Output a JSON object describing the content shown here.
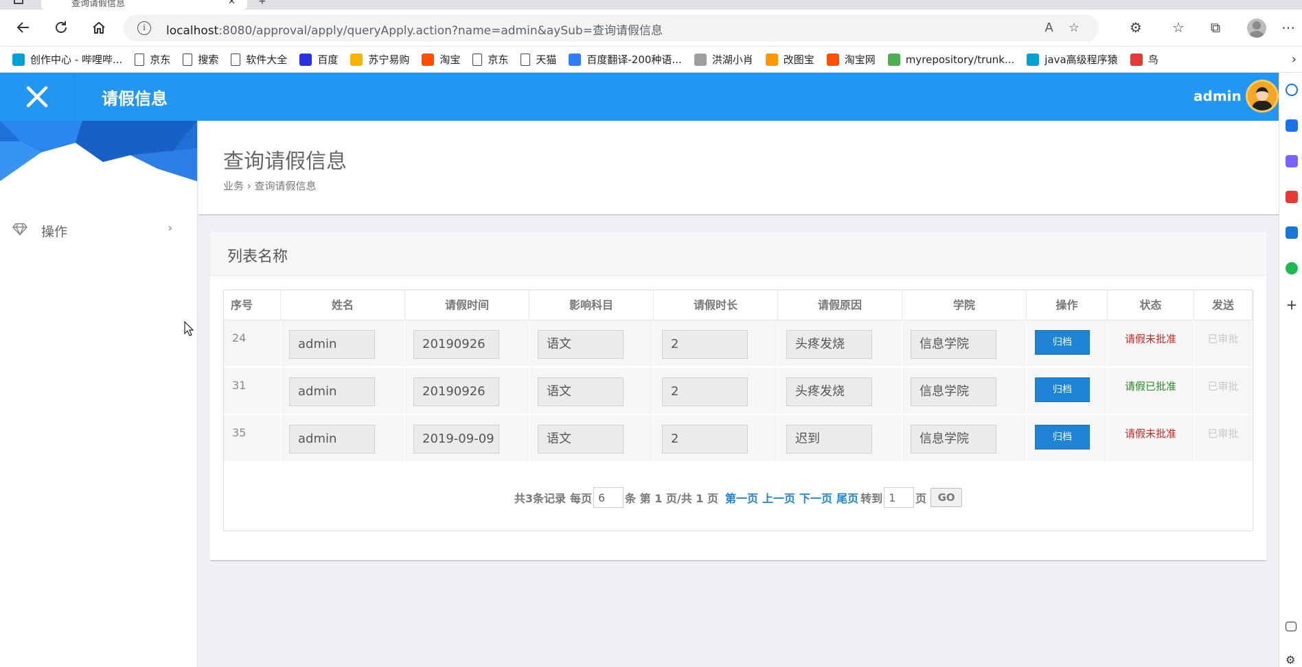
{
  "browser": {
    "tab_title": "查询请假信息",
    "url_host": "localhost",
    "url_rest": ":8080/approval/apply/queryApply.action?name=admin&aySub=查询请假信息",
    "bookmarks": [
      {
        "label": "创作中心 - 哔哩哔...",
        "icon": "bilibili-icon",
        "color": "#00a1d6"
      },
      {
        "label": "京东",
        "icon": "document-icon",
        "color": ""
      },
      {
        "label": "搜索",
        "icon": "document-icon",
        "color": ""
      },
      {
        "label": "软件大全",
        "icon": "document-icon",
        "color": ""
      },
      {
        "label": "百度",
        "icon": "baidu-icon",
        "color": "#2932e1"
      },
      {
        "label": "苏宁易购",
        "icon": "suning-icon",
        "color": "#f7b500"
      },
      {
        "label": "淘宝",
        "icon": "taobao-icon",
        "color": "#ff5000"
      },
      {
        "label": "京东",
        "icon": "document-icon",
        "color": ""
      },
      {
        "label": "天猫",
        "icon": "document-icon",
        "color": ""
      },
      {
        "label": "百度翻译-200种语...",
        "icon": "translate-icon",
        "color": "#2c7ef8"
      },
      {
        "label": "洪湖小肖",
        "icon": "avatar-icon",
        "color": "#9e9e9e"
      },
      {
        "label": "改图宝",
        "icon": "gaitubao-icon",
        "color": "#ff9800"
      },
      {
        "label": "淘宝网",
        "icon": "taobao-icon",
        "color": "#ff5000"
      },
      {
        "label": "myrepository/trunk...",
        "icon": "chrome-icon",
        "color": "#4caf50"
      },
      {
        "label": "java高级程序猿",
        "icon": "bilibili-icon",
        "color": "#00a1d6"
      },
      {
        "label": "鸟",
        "icon": "bird-icon",
        "color": "#e53935"
      }
    ]
  },
  "app": {
    "title": "请假信息",
    "user": "admin",
    "accent": "#2196f3"
  },
  "sidebar": {
    "items": [
      {
        "label": "操作",
        "icon": "diamond-icon"
      }
    ]
  },
  "page": {
    "title": "查询请假信息",
    "breadcrumb": "业务 › 查询请假信息"
  },
  "panel": {
    "title": "列表名称"
  },
  "table": {
    "columns": [
      "序号",
      "姓名",
      "请假时间",
      "影响科目",
      "请假时长",
      "请假原因",
      "学院",
      "操作",
      "状态",
      "发送"
    ],
    "archive_label": "归档",
    "rows": [
      {
        "id": "24",
        "name": "admin",
        "time": "20190926",
        "subject": "语文",
        "duration": "2",
        "reason": "头疼发烧",
        "college": "信息学院",
        "status": "请假未批准",
        "status_color": "#d9251d",
        "send": "已审批"
      },
      {
        "id": "31",
        "name": "admin",
        "time": "20190926",
        "subject": "语文",
        "duration": "2",
        "reason": "头疼发烧",
        "college": "信息学院",
        "status": "请假已批准",
        "status_color": "#2b8a2b",
        "send": "已审批"
      },
      {
        "id": "35",
        "name": "admin",
        "time": "2019-09-09",
        "subject": "语文",
        "duration": "2",
        "reason": "迟到",
        "college": "信息学院",
        "status": "请假未批准",
        "status_color": "#d9251d",
        "send": "已审批"
      }
    ]
  },
  "pager": {
    "total_text": "共3条记录",
    "per_page_label": "每页",
    "per_page_value": "6",
    "page_info": "条 第 1 页/共 1 页",
    "first": "第一页",
    "prev": "上一页",
    "next": "下一页",
    "last": "尾页",
    "goto_label": "转到",
    "goto_value": "1",
    "page_suffix": "页",
    "go": "GO"
  }
}
